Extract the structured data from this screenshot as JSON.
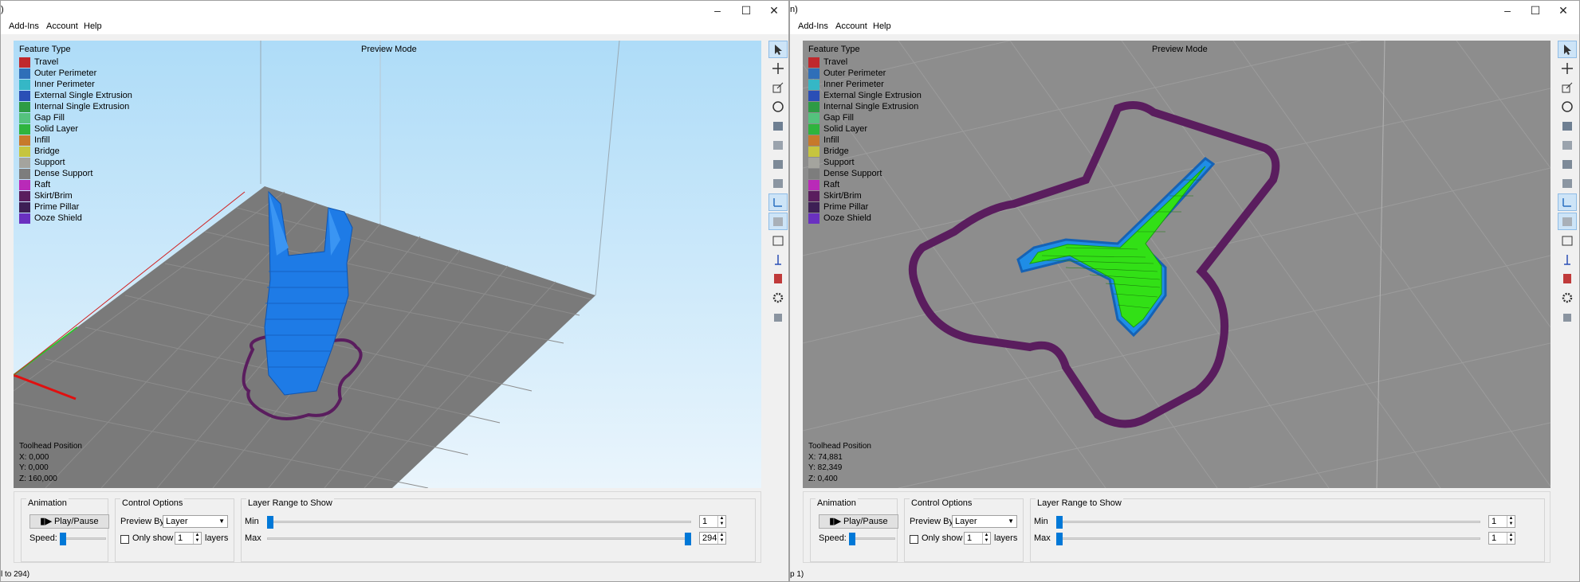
{
  "windows": [
    {
      "id": "left",
      "title_fragment": ")",
      "menu": [
        "Add-Ins",
        "Account",
        "Help"
      ],
      "preview_mode_label": "Preview Mode",
      "legend": {
        "title": "Feature Type",
        "items": [
          {
            "label": "Travel",
            "color": "#c0282d"
          },
          {
            "label": "Outer Perimeter",
            "color": "#2f6fb8"
          },
          {
            "label": "Inner Perimeter",
            "color": "#35b7c6"
          },
          {
            "label": "External Single Extrusion",
            "color": "#2a4fb6"
          },
          {
            "label": "Internal Single Extrusion",
            "color": "#2e9b45"
          },
          {
            "label": "Gap Fill",
            "color": "#54c27d"
          },
          {
            "label": "Solid Layer",
            "color": "#2eb43d"
          },
          {
            "label": "Infill",
            "color": "#c7792b"
          },
          {
            "label": "Bridge",
            "color": "#c6c53e"
          },
          {
            "label": "Support",
            "color": "#a4a49e"
          },
          {
            "label": "Dense Support",
            "color": "#7d7d7d"
          },
          {
            "label": "Raft",
            "color": "#b92ab8"
          },
          {
            "label": "Skirt/Brim",
            "color": "#5a1d5e"
          },
          {
            "label": "Prime Pillar",
            "color": "#3d1f55"
          },
          {
            "label": "Ooze Shield",
            "color": "#6a30c0"
          }
        ]
      },
      "toolhead": {
        "title": "Toolhead Position",
        "x": "X: 0,000",
        "y": "Y: 0,000",
        "z": "Z: 160,000"
      },
      "controls": {
        "animation_label": "Animation",
        "play_pause": "Play/Pause",
        "speed_label": "Speed:",
        "control_options_label": "Control Options",
        "preview_by_label": "Preview By",
        "preview_by_value": "Layer",
        "only_show_label": "Only show",
        "only_show_value": "1",
        "layers_label": "layers",
        "layer_range_label": "Layer Range to Show",
        "min_label": "Min",
        "min_value": "1",
        "max_label": "Max",
        "max_value": "294",
        "min_fraction": 0,
        "max_fraction": 1
      },
      "status_text": "l to 294)"
    },
    {
      "id": "right",
      "title_fragment": "n)",
      "menu": [
        "Add-Ins",
        "Account",
        "Help"
      ],
      "preview_mode_label": "Preview Mode",
      "legend": {
        "title": "Feature Type",
        "items": [
          {
            "label": "Travel",
            "color": "#c0282d"
          },
          {
            "label": "Outer Perimeter",
            "color": "#2f6fb8"
          },
          {
            "label": "Inner Perimeter",
            "color": "#35b7c6"
          },
          {
            "label": "External Single Extrusion",
            "color": "#2a4fb6"
          },
          {
            "label": "Internal Single Extrusion",
            "color": "#2e9b45"
          },
          {
            "label": "Gap Fill",
            "color": "#54c27d"
          },
          {
            "label": "Solid Layer",
            "color": "#2eb43d"
          },
          {
            "label": "Infill",
            "color": "#c7792b"
          },
          {
            "label": "Bridge",
            "color": "#c6c53e"
          },
          {
            "label": "Support",
            "color": "#a4a49e"
          },
          {
            "label": "Dense Support",
            "color": "#7d7d7d"
          },
          {
            "label": "Raft",
            "color": "#b92ab8"
          },
          {
            "label": "Skirt/Brim",
            "color": "#5a1d5e"
          },
          {
            "label": "Prime Pillar",
            "color": "#3d1f55"
          },
          {
            "label": "Ooze Shield",
            "color": "#6a30c0"
          }
        ]
      },
      "toolhead": {
        "title": "Toolhead Position",
        "x": "X: 74,881",
        "y": "Y: 82,349",
        "z": "Z: 0,400"
      },
      "controls": {
        "animation_label": "Animation",
        "play_pause": "Play/Pause",
        "speed_label": "Speed:",
        "control_options_label": "Control Options",
        "preview_by_label": "Preview By",
        "preview_by_value": "Layer",
        "only_show_label": "Only show",
        "only_show_value": "1",
        "layers_label": "layers",
        "layer_range_label": "Layer Range to Show",
        "min_label": "Min",
        "min_value": "1",
        "max_label": "Max",
        "max_value": "1",
        "min_fraction": 0,
        "max_fraction": 0
      },
      "status_text": "p 1)"
    }
  ]
}
